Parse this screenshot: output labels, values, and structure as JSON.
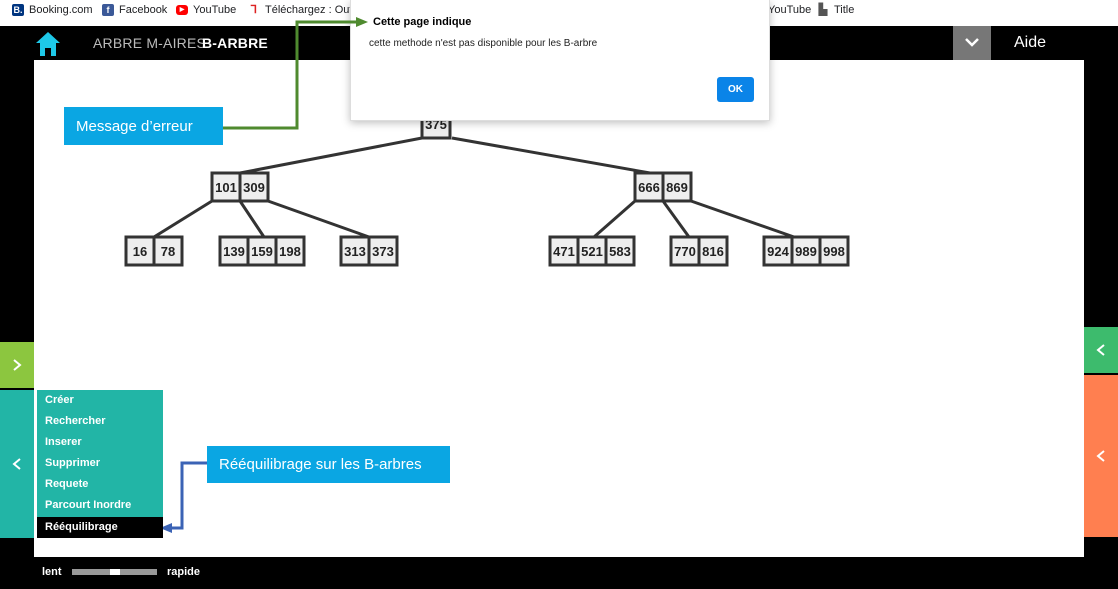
{
  "bookmarks": [
    {
      "label": "Booking.com",
      "icon": "booking-icon"
    },
    {
      "label": "Facebook",
      "icon": "facebook-icon"
    },
    {
      "label": "YouTube",
      "icon": "youtube-icon"
    },
    {
      "label": "Téléchargez : Outils",
      "icon": "download-tool-icon"
    },
    {
      "label": "YouTube",
      "icon": "youtube-icon"
    },
    {
      "label": "Title",
      "icon": "document-icon"
    }
  ],
  "header": {
    "nav": [
      "ARBRE M-AIRES",
      "B-ARBRE"
    ],
    "active_nav": "B-ARBRE",
    "help": "Aide"
  },
  "dialog": {
    "title": "Cette page indique",
    "message": "cette methode n'est pas disponible pour les B-arbre",
    "ok": "OK"
  },
  "tree": {
    "root": [
      "375"
    ],
    "level1": [
      [
        "101",
        "309"
      ],
      [
        "666",
        "869"
      ]
    ],
    "leaves": [
      [
        "16",
        "78"
      ],
      [
        "139",
        "159",
        "198"
      ],
      [
        "313",
        "373"
      ],
      [
        "471",
        "521",
        "583"
      ],
      [
        "770",
        "816"
      ],
      [
        "924",
        "989",
        "998"
      ]
    ]
  },
  "menu": {
    "items": [
      "Créer",
      "Rechercher",
      "Inserer",
      "Supprimer",
      "Requete",
      "Parcourt Inordre",
      "Rééquilibrage"
    ],
    "active": "Rééquilibrage"
  },
  "callouts": {
    "error": "Message d’erreur",
    "rebalance": "Rééquilibrage sur les B-arbres"
  },
  "speed": {
    "slow": "lent",
    "fast": "rapide",
    "value": 0.5
  },
  "colors": {
    "accent_menu": "#22b5a6",
    "callout": "#0aa6e3",
    "side_green": "#8cc63f",
    "right_green": "#3dbb6d",
    "right_orange": "#ff7f50",
    "ok_button": "#0a84e8",
    "home_icon": "#1ec8e8"
  }
}
